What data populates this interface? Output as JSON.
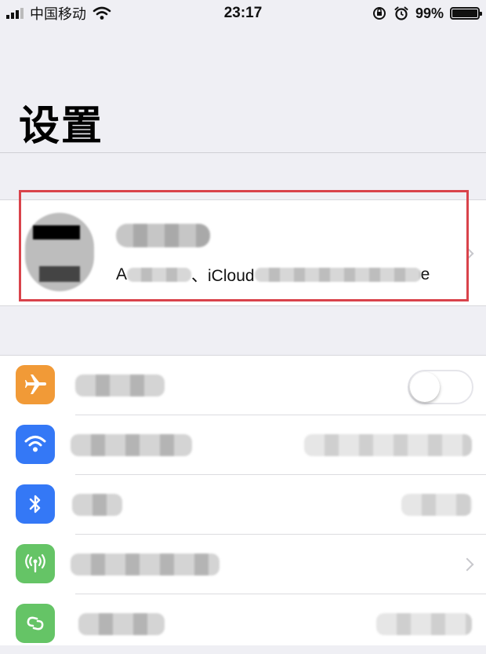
{
  "status_bar": {
    "carrier": "中国移动",
    "time": "23:17",
    "battery": "99%",
    "battery_level": 0.99
  },
  "page": {
    "title": "设置"
  },
  "account": {
    "subtitle_start": "A",
    "subtitle_mid": "、iCloud",
    "subtitle_end": "e"
  },
  "colors": {
    "airplane": "#f19a37",
    "wifi": "#3478f6",
    "bluetooth": "#3478f6",
    "cellular": "#65c466",
    "hotspot": "#65c466",
    "highlight": "#d9434b"
  },
  "rows": [
    {
      "icon": "airplane-icon",
      "control": "toggle",
      "toggle_on": false
    },
    {
      "icon": "wifi-icon",
      "control": "value"
    },
    {
      "icon": "bluetooth-icon",
      "control": "value"
    },
    {
      "icon": "cellular-icon",
      "control": "chevron"
    },
    {
      "icon": "hotspot-icon",
      "control": "value"
    }
  ]
}
